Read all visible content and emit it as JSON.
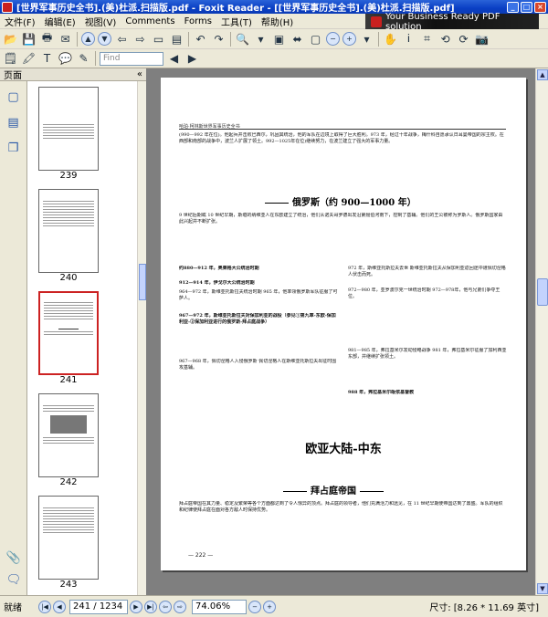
{
  "window": {
    "title": "[世界军事历史全书].(美)杜派.扫描版.pdf - Foxit Reader - [[世界军事历史全书].(美)杜派.扫描版.pdf]",
    "controls": [
      "_",
      "□",
      "×"
    ]
  },
  "menu": [
    "文件(F)",
    "编辑(E)",
    "视图(V)",
    "Comments",
    "Forms",
    "工具(T)",
    "帮助(H)"
  ],
  "banner": "Your Business Ready PDF solution",
  "toolbar": {
    "find_placeholder": "Find"
  },
  "left_panel": {
    "header": "页面",
    "collapse": "«",
    "thumbnails": [
      {
        "label": "239",
        "selected": false
      },
      {
        "label": "240",
        "selected": false
      },
      {
        "label": "241",
        "selected": true
      },
      {
        "label": "242",
        "selected": false
      },
      {
        "label": "243",
        "selected": false
      }
    ]
  },
  "document": {
    "running_head": "哈珀·柯林斯世界军事历史全书",
    "intro_para": "(990—992 年在位)。他起兵并击败巴西尔，巩固其统治，他的军队在边境上取得了巨大胜利。973 年，经过十年战争，梅什科自愿承认日耳曼帝国的宗主权。在西部和南部的战争中，波兰人扩展了领土。992—1025年在位)继续努力，在波兰建立了强大的军事力量。",
    "section1_title": "俄罗斯（约 900—1000 年）",
    "section1_intro": "9 世纪后期或 10 世纪早期，斯堪的纳维亚人在东欧建立了统治，他们从诺夫哥罗德出发沿第聂伯河南下，控制了基辅。他们的王公被称为罗斯人。俄罗斯国家由此兴起并不断扩张。",
    "left_col": [
      "约880—912 年，奥莱格大公统治时期",
      "912—914 年，伊戈尔大公统治时期",
      "964—972 年，斯维亚托斯拉夫统治时期 965 年，他率领俄罗斯军队征服了可萨人。",
      "967—972 年，斯维亚托斯拉夫对保加利亚的战役（参见①第九章-东欧-保加利亚-②保加利亚进行的俄罗斯-拜占庭战争）",
      "967—968 年，佩切涅格人入侵俄罗斯 佩切涅格人在斯维亚托斯拉夫出征时围攻基辅。"
    ],
    "right_col": [
      "972 年，斯维亚托斯拉夫去世 斯维亚托斯拉夫从保加利亚返回途中遭佩切涅格人伏击而死。",
      "972—980 年，亚罗波尔克一世统治时期 972—978年，他与兄弟们争夺王位。",
      "981—985 年，弗拉基米尔发动侵略战争 981 年，弗拉基米尔征服了加利西亚东部，并继续扩张领土。",
      "988 年，弗拉基米尔皈依基督教"
    ],
    "chapter_title": "欧亚大陆-中东",
    "section2_title": "拜占庭帝国",
    "section2_para": "拜占庭帝国在其力量、稳定及繁荣等各个方面都达到了令人惊异的顶点。拜占庭的领导者，他们充满活力和远见，在 11 世纪早期使帝国达到了鼎盛。军队的组织和纪律使拜占庭在面对各方敌人时保持优势。",
    "page_number": "— 222 —"
  },
  "status": {
    "ready": "就绪",
    "page_indicator": "241 / 1234",
    "zoom": "74.06%",
    "page_size": "尺寸: [8.26 * 11.69 英寸]"
  }
}
